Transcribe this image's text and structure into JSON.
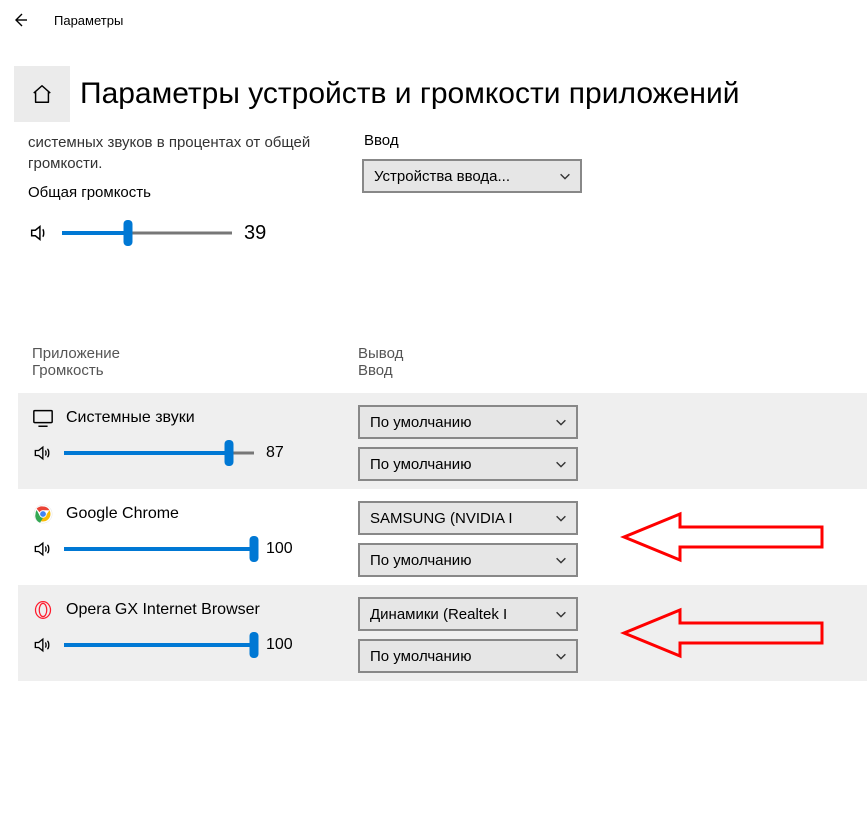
{
  "window_title": "Параметры",
  "page_title": "Параметры устройств и громкости приложений",
  "description": "системных звуков в процентах от общей громкости.",
  "master": {
    "label": "Общая громкость",
    "value": 39
  },
  "right_panel": {
    "input_label": "Ввод",
    "input_dropdown": "Устройства ввода..."
  },
  "list_headers": {
    "app": "Приложение",
    "volume": "Громкость",
    "output": "Вывод",
    "input": "Ввод"
  },
  "default_label": "По умолчанию",
  "apps": [
    {
      "name": "Системные звуки",
      "volume": 87,
      "output": "По умолчанию",
      "input": "По умолчанию",
      "icon": "monitor",
      "shaded": true
    },
    {
      "name": "Google Chrome",
      "volume": 100,
      "output": "SAMSUNG (NVIDIA I",
      "input": "По умолчанию",
      "icon": "chrome",
      "shaded": false,
      "arrow": true
    },
    {
      "name": "Opera GX Internet Browser",
      "volume": 100,
      "output": "Динамики (Realtek I",
      "input": "По умолчанию",
      "icon": "opera",
      "shaded": true,
      "arrow": true
    }
  ]
}
